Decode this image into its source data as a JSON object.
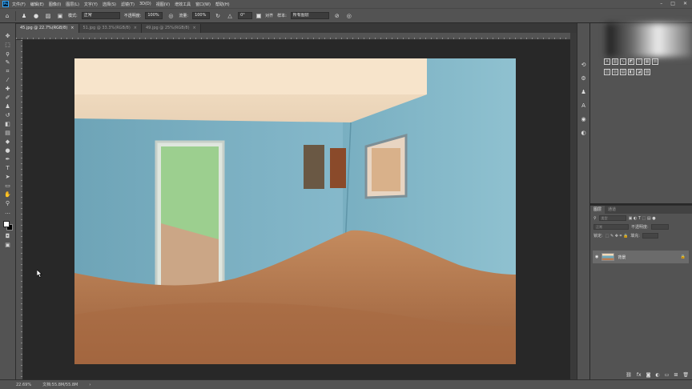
{
  "app": {
    "logo_text": "Ps",
    "menu": [
      "文件(F)",
      "编辑(E)",
      "图像(I)",
      "图层(L)",
      "文字(Y)",
      "选择(S)",
      "滤镜(T)",
      "3D(D)",
      "视图(V)",
      "增效工具",
      "窗口(W)",
      "帮助(H)"
    ],
    "window_controls": [
      "–",
      "□",
      "✕"
    ]
  },
  "options": {
    "mode_label": "模式:",
    "mode_value": "正常",
    "opacity_label": "不透明度:",
    "opacity_value": "100%",
    "flow_label": "流量:",
    "flow_value": "100%",
    "angle_value": "0°",
    "align_label": "对齐",
    "sample_label": "样本:",
    "sample_value": "所有图层"
  },
  "tabs": [
    {
      "label": "45.jpg @ 22.7%(RGB/8)",
      "active": true
    },
    {
      "label": "51.jpg @ 33.3%(RGB/8)",
      "active": false
    },
    {
      "label": "49.jpg @ 25%(RGB/8)",
      "active": false
    }
  ],
  "tools": [
    "move-icon",
    "marquee-icon",
    "lasso-icon",
    "quick-select-icon",
    "crop-icon",
    "eyedropper-icon",
    "healing-icon",
    "brush-icon",
    "clone-stamp-icon",
    "history-brush-icon",
    "eraser-icon",
    "gradient-icon",
    "blur-icon",
    "dodge-icon",
    "pen-icon",
    "type-icon",
    "path-select-icon",
    "shape-icon",
    "hand-icon",
    "zoom-icon",
    "more-icon"
  ],
  "layers_panel": {
    "tabs": [
      "图层",
      "通道"
    ],
    "kind_label": "类型",
    "blend_value": "正常",
    "opacity_label": "不透明度:",
    "lock_label": "锁定:",
    "fill_label": "填充:",
    "layer_name": "背景"
  },
  "status": {
    "zoom": "22.69%",
    "doc": "文档:55.8M/55.8M"
  },
  "colors": {
    "fg": "#ffffff",
    "bg": "#000000"
  }
}
